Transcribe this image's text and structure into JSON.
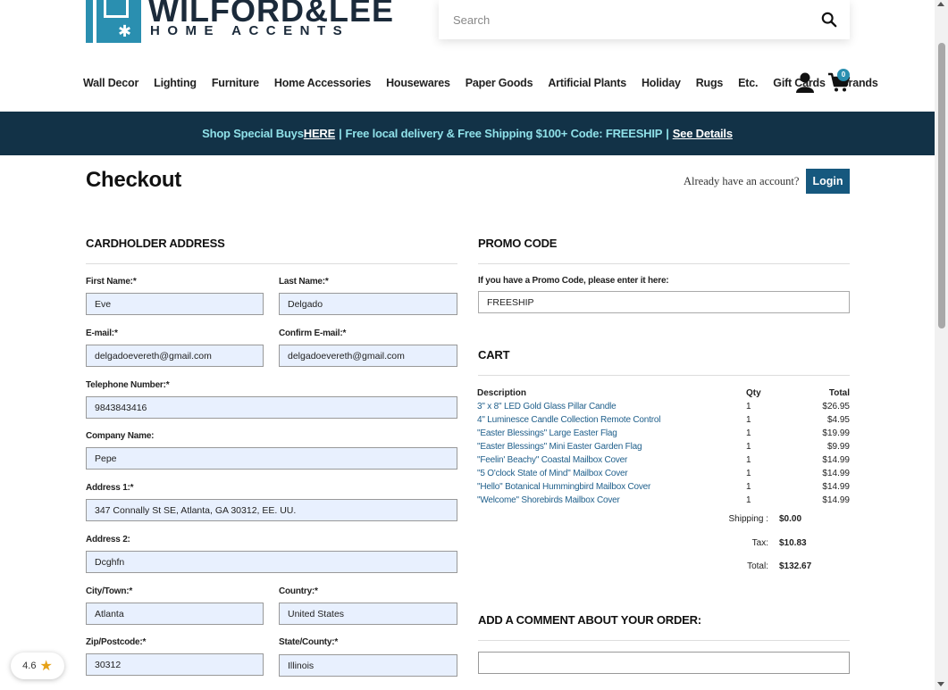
{
  "brand": {
    "name": "WILFORD&LEE",
    "tagline": "HOME ACCENTS"
  },
  "search": {
    "placeholder": "Search"
  },
  "nav": {
    "items": [
      "Wall Decor",
      "Lighting",
      "Furniture",
      "Home Accessories",
      "Housewares",
      "Paper Goods",
      "Artificial Plants",
      "Holiday",
      "Rugs",
      "Etc.",
      "Gift Cards",
      "Brands"
    ],
    "cart_count": "0"
  },
  "banner": {
    "part1": "Shop Special Buys ",
    "link1": "HERE",
    "part2": " Free local delivery & Free Shipping $100+ Code: FREESHIP ",
    "link2": "See Details",
    "sep": "|"
  },
  "checkout": {
    "title": "Checkout",
    "account_prompt": "Already have an account?",
    "login_label": "Login"
  },
  "cardholder": {
    "heading": "CARDHOLDER ADDRESS",
    "first_name_label": "First Name:*",
    "first_name": "Eve",
    "last_name_label": "Last Name:*",
    "last_name": "Delgado",
    "email_label": "E-mail:*",
    "email": "delgadoevereth@gmail.com",
    "confirm_email_label": "Confirm E-mail:*",
    "confirm_email": "delgadoevereth@gmail.com",
    "phone_label": "Telephone Number:*",
    "phone": "9843843416",
    "company_label": "Company Name:",
    "company": "Pepe",
    "address1_label": "Address 1:*",
    "address1": "347 Connally St SE, Atlanta, GA 30312, EE. UU.",
    "address2_label": "Address 2:",
    "address2": "Dcghfn",
    "city_label": "City/Town:*",
    "city": "Atlanta",
    "country_label": "Country:*",
    "country": "United States",
    "zip_label": "Zip/Postcode:*",
    "zip": "30312",
    "state_label": "State/County:*",
    "state": "Illinois"
  },
  "promo": {
    "heading": "PROMO CODE",
    "prompt": "If you have a Promo Code, please enter it here:",
    "value": "FREESHIP"
  },
  "cart": {
    "heading": "CART",
    "col_description": "Description",
    "col_qty": "Qty",
    "col_total": "Total",
    "items": [
      {
        "desc": "3\" x 8\" LED Gold Glass Pillar Candle",
        "qty": "1",
        "total": "$26.95"
      },
      {
        "desc": "4\" Luminesce Candle Collection Remote Control",
        "qty": "1",
        "total": "$4.95"
      },
      {
        "desc": "\"Easter Blessings\" Large Easter Flag",
        "qty": "1",
        "total": "$19.99"
      },
      {
        "desc": "\"Easter Blessings\" Mini Easter Garden Flag",
        "qty": "1",
        "total": "$9.99"
      },
      {
        "desc": "\"Feelin' Beachy\" Coastal Mailbox Cover",
        "qty": "1",
        "total": "$14.99"
      },
      {
        "desc": "\"5 O'clock State of Mind\" Mailbox Cover",
        "qty": "1",
        "total": "$14.99"
      },
      {
        "desc": "\"Hello\" Botanical Hummingbird Mailbox Cover",
        "qty": "1",
        "total": "$14.99"
      },
      {
        "desc": "\"Welcome\" Shorebirds Mailbox Cover",
        "qty": "1",
        "total": "$14.99"
      }
    ],
    "shipping_label": "Shipping :",
    "shipping": "$0.00",
    "tax_label": "Tax:",
    "tax": "$10.83",
    "total_label": "Total:",
    "total": "$132.67"
  },
  "comment": {
    "heading": "ADD A COMMENT ABOUT YOUR ORDER:",
    "value": ""
  },
  "rating": {
    "score": "4.6"
  },
  "colors": {
    "banner_bg": "#123247",
    "banner_text": "#8fe0e8",
    "accent": "#16587e",
    "link": "#1f5f8b",
    "input_bg": "#e8f0fe"
  }
}
